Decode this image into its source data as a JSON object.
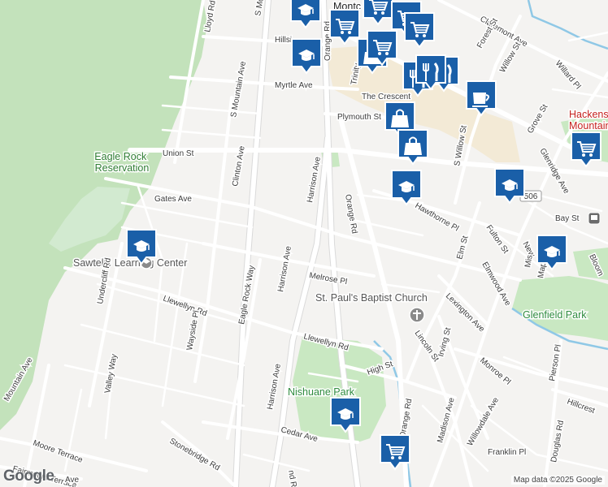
{
  "colors": {
    "background": "#f4f3f1",
    "park": "#c9e8c2",
    "reservation": "#bfe0b8",
    "road": "#ffffff",
    "road_casing": "#d8d8d8",
    "water": "#8fc8e6",
    "marker_fill": "#1a5fa8",
    "marker_border": "#ffffff",
    "park_text": "#2e8b3e",
    "poi_red": "#c5221f"
  },
  "labels": {
    "eagle_rock_reservation": "Eagle Rock\nReservation",
    "sawtelle_learning_center": "Sawtelle Learning Center",
    "st_pauls_church": "St. Paul's Baptist Church",
    "glenfield_park": "Glenfield Park",
    "nishuane_park": "Nishuane Park",
    "hackensack_mountains": "Hackens\nMountains",
    "montclair": "Montc",
    "route_506": "506"
  },
  "streets": [
    "Lloyd Rd",
    "S Mo",
    "Hillsi",
    "Myrtle Ave",
    "S Mountain Ave",
    "Orange Rd",
    "Union St",
    "Clinton Ave",
    "Harrison Ave",
    "Gates Ave",
    "Plymouth St",
    "The Crescent",
    "Trinity",
    "Claremont Ave",
    "Forest St",
    "Willow St",
    "Willard Pl",
    "Grove St",
    "Glenridge Ave",
    "Gates Ave",
    "S Willow St",
    "Hawthorne Pl",
    "Fulton St",
    "Elm St",
    "Elmwood Ave",
    "Bay St",
    "New",
    "Mis",
    "Map",
    "Bloom",
    "Melrose Pl",
    "Llewellyn Rd",
    "Undercliff Rd",
    "Eagle Rock Way",
    "Wayside Pl",
    "Lexington Ave",
    "Irving St",
    "Lincoln St",
    "Monroe Pl",
    "Pierson Pl",
    "Hillcrest",
    "High St",
    "Mountain Ave",
    "Valley Way",
    "Madison Ave",
    "Willowdale Ave",
    "Douglas Rd",
    "Franklin Pl",
    "Cedar Ave",
    "Stonebridge Rd",
    "Moore Terrace",
    "Fairmount Terrace",
    "Ave",
    "nd Rd",
    "Llewellyn Rd",
    "Harrison Ave",
    "Orange Rd",
    "Harrison Ave",
    "Orange Rd"
  ],
  "markers": [
    {
      "type": "school",
      "icon": "graduation-cap-icon"
    },
    {
      "type": "school",
      "icon": "graduation-cap-icon"
    },
    {
      "type": "grocery",
      "icon": "shopping-cart-icon"
    },
    {
      "type": "grocery",
      "icon": "shopping-cart-icon"
    },
    {
      "type": "grocery",
      "icon": "shopping-cart-icon"
    },
    {
      "type": "grocery",
      "icon": "shopping-cart-icon"
    },
    {
      "type": "shopping",
      "icon": "shopping-bag-icon"
    },
    {
      "type": "grocery",
      "icon": "shopping-cart-icon"
    },
    {
      "type": "restaurant",
      "icon": "fork-knife-icon"
    },
    {
      "type": "restaurant",
      "icon": "fork-knife-icon"
    },
    {
      "type": "restaurant",
      "icon": "fork-knife-icon"
    },
    {
      "type": "cafe",
      "icon": "coffee-cup-icon"
    },
    {
      "type": "shopping",
      "icon": "shopping-bag-icon"
    },
    {
      "type": "shopping",
      "icon": "shopping-bag-icon"
    },
    {
      "type": "school",
      "icon": "graduation-cap-icon"
    },
    {
      "type": "school",
      "icon": "graduation-cap-icon"
    },
    {
      "type": "grocery",
      "icon": "shopping-cart-icon"
    },
    {
      "type": "school",
      "icon": "graduation-cap-icon"
    },
    {
      "type": "school",
      "icon": "graduation-cap-icon"
    },
    {
      "type": "school",
      "icon": "graduation-cap-icon"
    },
    {
      "type": "grocery",
      "icon": "shopping-cart-icon"
    }
  ],
  "attribution": "Map data ©2025 Google",
  "logo": "Google"
}
